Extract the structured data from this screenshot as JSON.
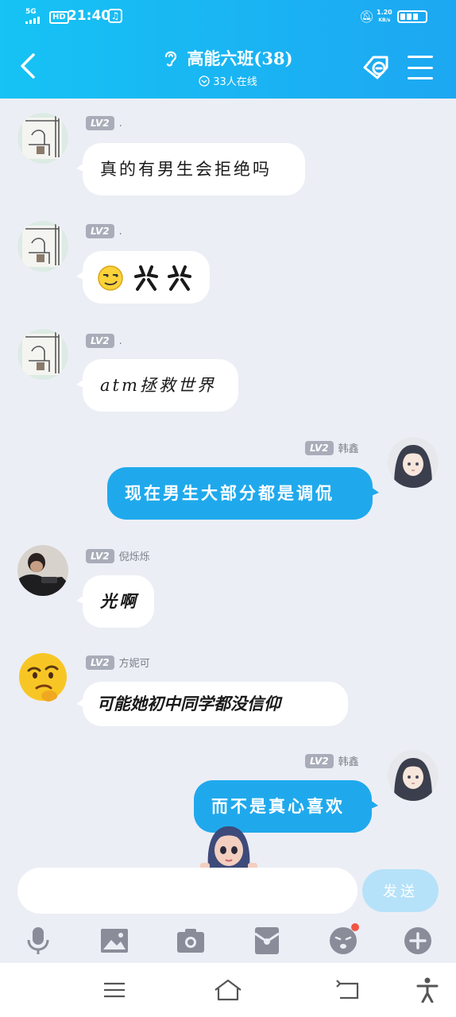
{
  "status_bar": {
    "signal": "5G",
    "hd": "HD",
    "time": "21:40",
    "net_speed": "1.20",
    "net_unit": "KB/s"
  },
  "header": {
    "title": "高能六班(38)",
    "online": "33人在线"
  },
  "messages": [
    {
      "level": "LV2",
      "name": ".",
      "text": "真的有男生会拒绝吗"
    },
    {
      "level": "LV2",
      "name": ".",
      "text": ""
    },
    {
      "level": "LV2",
      "name": ".",
      "text": "atm拯救世界"
    },
    {
      "level": "LV2",
      "name": "韩鑫",
      "text": "现在男生大部分都是调侃"
    },
    {
      "level": "LV2",
      "name": "倪烁烁",
      "text": "光啊"
    },
    {
      "level": "LV2",
      "name": "方妮可",
      "text": "可能她初中同学都没信仰"
    },
    {
      "level": "LV2",
      "name": "韩鑫",
      "text": "而不是真心喜欢"
    }
  ],
  "input": {
    "value": "",
    "placeholder": "",
    "send_label": "发送"
  },
  "toolbar_icons": [
    "microphone-icon",
    "image-icon",
    "camera-icon",
    "red-packet-icon",
    "emoji-icon",
    "plus-icon"
  ],
  "colors": {
    "header_start": "#16c3f4",
    "header_end": "#1da7f2",
    "bubble_self": "#1fa9ec",
    "bubble_other": "#ffffff",
    "background": "#eceef5",
    "level_badge": "#a9adb9",
    "send_disabled": "#b6e2f9",
    "notification_dot": "#f05545"
  }
}
